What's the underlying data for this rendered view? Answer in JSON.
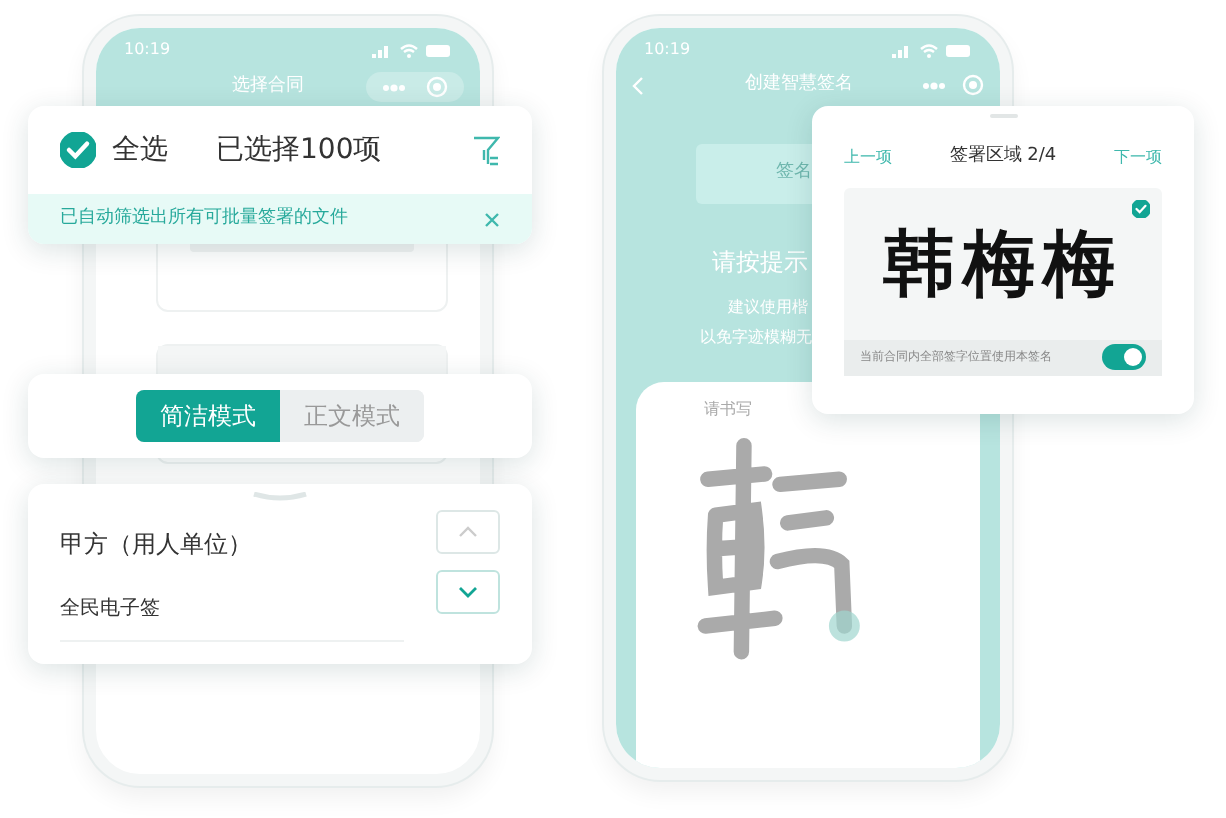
{
  "left_phone": {
    "status_time": "10:19",
    "title": "选择合同"
  },
  "select_card": {
    "select_all": {
      "label": "全选",
      "checked": true
    },
    "count": "已选择100项",
    "notice": "已自动筛选出所有可批量签署的文件"
  },
  "mode_card": {
    "modes": [
      {
        "label": "简洁模式",
        "selected": true
      },
      {
        "label": "正文模式",
        "selected": false
      }
    ]
  },
  "party_card": {
    "label": "甲方（用人单位）",
    "value": "全民电子签"
  },
  "right_phone": {
    "status_time": "10:19",
    "title": "创建智慧签名",
    "button": "签名",
    "hint_title": "请按提示",
    "hint_lines": [
      "建议使用楷",
      "以免字迹模糊无"
    ],
    "sheet_hint": "请书写"
  },
  "signature_card": {
    "prev": "上一项",
    "area": "签署区域 2/4",
    "next": "下一项",
    "signature": "韩梅梅",
    "signature_checked": true,
    "apply_all": {
      "label": "当前合同内全部签字位置使用本签名",
      "on": true
    }
  }
}
